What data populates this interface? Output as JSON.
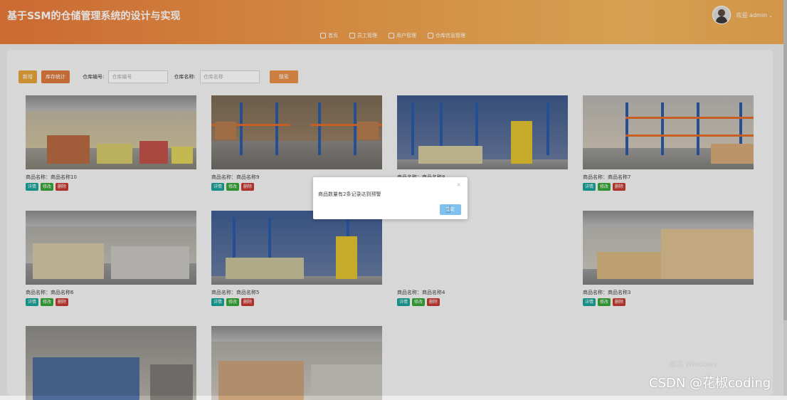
{
  "header": {
    "title": "基于SSM的仓储管理系统的设计与实现",
    "welcome": "欢迎 admin",
    "nav": [
      {
        "label": "首页",
        "icon": "home-icon"
      },
      {
        "label": "员工管理",
        "icon": "users-icon"
      },
      {
        "label": "用户管理",
        "icon": "user-icon"
      },
      {
        "label": "仓库信息管理",
        "icon": "warehouse-icon"
      }
    ]
  },
  "toolbar": {
    "add_label": "新增",
    "stats_label": "库存统计",
    "warehouse_no_label": "仓库编号:",
    "warehouse_no_placeholder": "仓库编号",
    "warehouse_name_label": "仓库名称:",
    "warehouse_name_placeholder": "仓库名称",
    "search_label": "搜索"
  },
  "goods": [
    {
      "name": "商品名称：商品名称10"
    },
    {
      "name": "商品名称：商品名称9"
    },
    {
      "name": "商品名称：商品名称8"
    },
    {
      "name": "商品名称：商品名称7"
    },
    {
      "name": "商品名称：商品名称6"
    },
    {
      "name": "商品名称：商品名称5"
    },
    {
      "name": "商品名称：商品名称4"
    },
    {
      "name": "商品名称：商品名称3"
    },
    {
      "name": ""
    },
    {
      "name": ""
    }
  ],
  "actions": {
    "detail": "详情",
    "edit": "修改",
    "delete": "删除"
  },
  "dialog": {
    "message": "商品数量有2条记录达到预警",
    "ok_label": "确定",
    "close_glyph": "×"
  },
  "watermarks": {
    "windows": "激活 Windows",
    "csdn": "CSDN @花椒coding"
  }
}
